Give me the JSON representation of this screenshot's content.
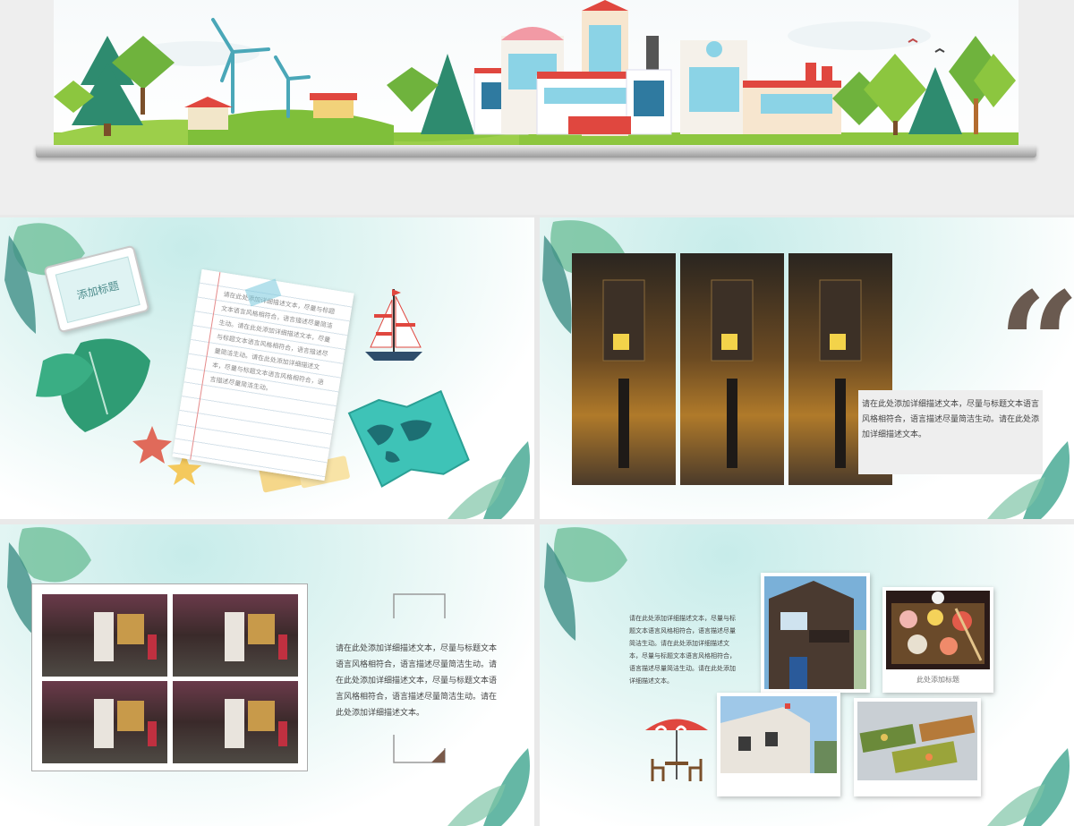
{
  "slide1": {
    "title_tag": "添加标题",
    "note_text": "请在此处添加详细描述文本，尽量与标题文本语言风格相符合，语言描述尽量简洁生动。请在此处添加详细描述文本，尽量与标题文本语言风格相符合，语言描述尽量简洁生动。请在此处添加详细描述文本，尽量与标题文本语言风格相符合，语言描述尽量简洁生动。"
  },
  "slide2": {
    "quote_mark": "“",
    "body": "请在此处添加详细描述文本，尽量与标题文本语言风格相符合，语言描述尽量简洁生动。请在此处添加详细描述文本。"
  },
  "slide3": {
    "body": "请在此处添加详细描述文本，尽量与标题文本语言风格相符合，语言描述尽量简洁生动。请在此处添加详细描述文本，尽量与标题文本语言风格相符合，语言描述尽量简洁生动。请在此处添加详细描述文本。"
  },
  "slide4": {
    "body": "请在此处添加详细描述文本，尽量与标题文本语言风格相符合，语言描述尽量简洁生动。请在此处添加详细描述文本，尽量与标题文本语言风格相符合，语言描述尽量简洁生动。请在此处添加详细描述文本。",
    "caption": "此处添加标题"
  },
  "colors": {
    "accent_teal": "#3fb8a8",
    "leaf_green": "#2f9c74",
    "brick_red": "#e0473f",
    "panel_gray": "#eeeeee"
  }
}
